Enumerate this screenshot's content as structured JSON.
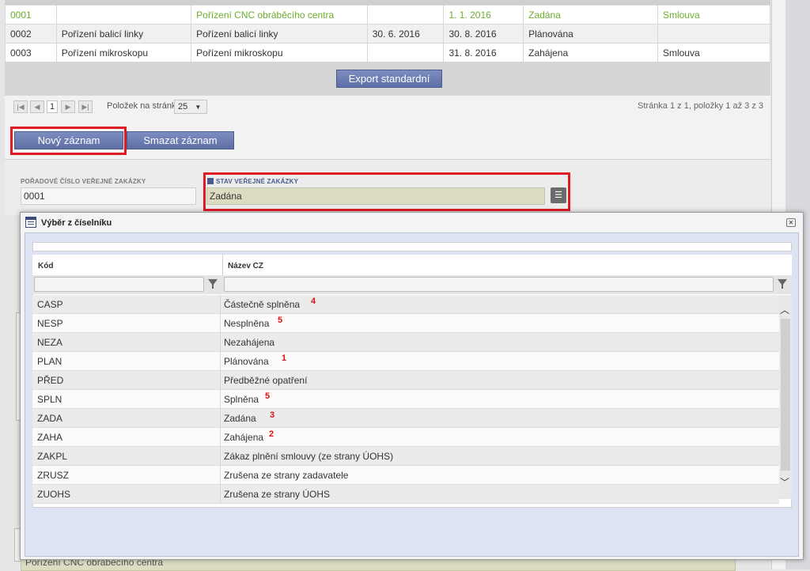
{
  "top_table": {
    "rows": [
      [
        "0001",
        "",
        "Pořízení CNC obráběcího centra",
        "",
        "1. 1. 2016",
        "Zadána",
        "Smlouva"
      ],
      [
        "0002",
        "Pořízení balicí linky",
        "Pořízení balicí linky",
        "30. 6. 2016",
        "30. 8. 2016",
        "Plánována",
        ""
      ],
      [
        "0003",
        "Pořízení mikroskopu",
        "Pořízení mikroskopu",
        "",
        "31. 8. 2016",
        "Zahájena",
        "Smlouva"
      ]
    ],
    "highlight_color": "#6bae2a"
  },
  "export_button": "Export standardní",
  "pager": {
    "first": "|◀",
    "prev": "◀",
    "current": "1",
    "next": "▶",
    "last": "▶|",
    "page_size_label": "Položek na stránku",
    "page_size": "25",
    "info": "Stránka 1 z 1, položky 1 až 3 z 3"
  },
  "actions": {
    "new": "Nový záznam",
    "delete": "Smazat záznam"
  },
  "form": {
    "number_label": "POŘADOVÉ ČÍSLO VEŘEJNÉ ZAKÁZKY",
    "number_value": "0001",
    "state_label": "STAV VEŘEJNÉ ZAKÁZKY",
    "state_value": "Zadána"
  },
  "background_field_text": "Pořízení CNC obráběcího centra",
  "dialog": {
    "title": "Výběr z číselníku",
    "close": "✕",
    "columns": {
      "code": "Kód",
      "name": "Název CZ"
    },
    "rows": [
      {
        "code": "CASP",
        "name": "Částečně splněna",
        "mark": "4"
      },
      {
        "code": "NESP",
        "name": "Nesplněna",
        "mark": "5"
      },
      {
        "code": "NEZA",
        "name": "Nezahájena",
        "mark": ""
      },
      {
        "code": "PLAN",
        "name": "Plánována",
        "mark": "1"
      },
      {
        "code": "PŘED",
        "name": "Předběžné opatření",
        "mark": ""
      },
      {
        "code": "SPLN",
        "name": "Splněna",
        "mark": "5"
      },
      {
        "code": "ZADA",
        "name": "Zadána",
        "mark": "3"
      },
      {
        "code": "ZAHA",
        "name": "Zahájena",
        "mark": "2"
      },
      {
        "code": "ZAKPL",
        "name": "Zákaz plnění smlouvy (ze strany ÚOHS)",
        "mark": ""
      },
      {
        "code": "ZRUSZ",
        "name": "Zrušena ze strany zadavatele",
        "mark": ""
      },
      {
        "code": "ZUOHS",
        "name": "Zrušena ze strany ÚOHS",
        "mark": ""
      }
    ]
  },
  "colors": {
    "annotation_red": "#e01b24",
    "button_blue": "#6a7cb3"
  }
}
